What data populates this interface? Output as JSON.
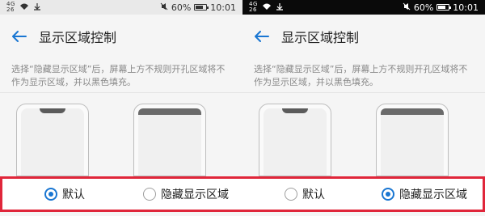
{
  "colors": {
    "accent": "#1976d2",
    "highlight_border": "#e0263a",
    "status_bar_dark": "#0a0a0a",
    "status_bar_light": "#e9e9e9"
  },
  "left": {
    "status": {
      "signal_text": "4G\n26",
      "battery": "60%",
      "time": "10:01"
    },
    "header": {
      "title": "显示区域控制"
    },
    "description": "选择“隐藏显示区域”后，屏幕上方不规则开孔区域将不作为显示区域，并以黑色填充。",
    "options": [
      {
        "label": "默认",
        "checked": true
      },
      {
        "label": "隐藏显示区域",
        "checked": false
      }
    ]
  },
  "right": {
    "status": {
      "signal_text": "4G\n26",
      "battery": "60%",
      "time": "10:01"
    },
    "header": {
      "title": "显示区域控制"
    },
    "description": "选择“隐藏显示区域”后，屏幕上方不规则开孔区域将不作为显示区域，并以黑色填充。",
    "options": [
      {
        "label": "默认",
        "checked": false
      },
      {
        "label": "隐藏显示区域",
        "checked": true
      }
    ]
  }
}
